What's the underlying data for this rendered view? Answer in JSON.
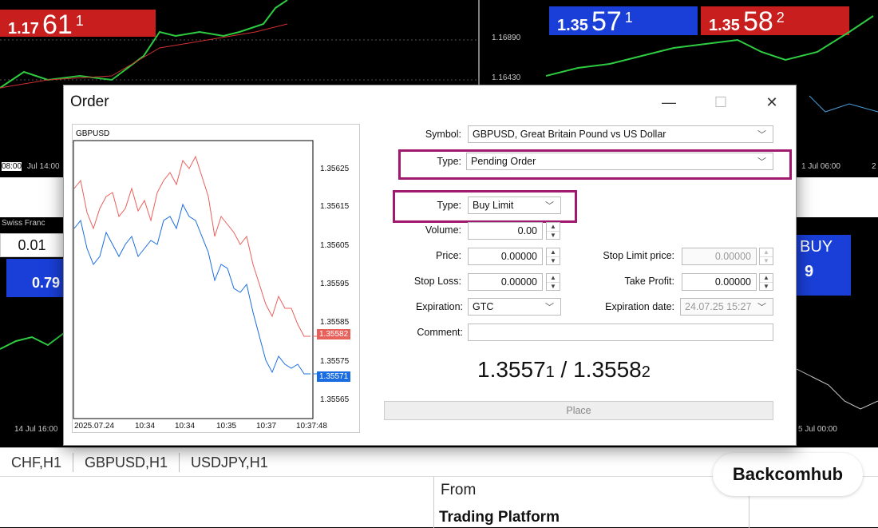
{
  "background": {
    "chart_tl": {
      "bid_small": "1.17",
      "bid_big": "61",
      "bid_sup": "1",
      "axis_labels": [
        "1.16890",
        "1.16430"
      ],
      "time_labels": [
        "08:00",
        "Jul 14:00"
      ]
    },
    "chart_tr": {
      "bid_small": "1.35",
      "bid_big": "57",
      "bid_sup": "1",
      "ask_small": "1.35",
      "ask_big": "58",
      "ask_sup": "2",
      "time_labels": [
        "1 Jul 06:00",
        "2"
      ]
    },
    "chart_ml": {
      "title": "Swiss Franc",
      "lot": "0.01",
      "price": "0.79"
    },
    "chart_mr": {
      "buy_label": "BUY",
      "price": "9"
    },
    "chart_bl": {
      "time_label": "14 Jul 16:00"
    },
    "chart_br": {
      "time_label": "5 Jul 00:00"
    }
  },
  "bottom_tabs": [
    "CHF,H1",
    "GBPUSD,H1",
    "USDJPY,H1"
  ],
  "lower_panel": {
    "from": "From",
    "trading_platform": "Trading Platform"
  },
  "logo": "Backcomhub",
  "dialog": {
    "title": "Order",
    "buttons": {
      "minimize": "—",
      "maximize": "☐",
      "close": "✕"
    },
    "mini_chart": {
      "symbol": "GBPUSD",
      "y_ticks": [
        "1.35625",
        "1.35615",
        "1.35605",
        "1.35595",
        "1.35585",
        "1.35575",
        "1.35565"
      ],
      "x_ticks": [
        "2025.07.24",
        "10:34",
        "10:34",
        "10:35",
        "10:37",
        "10:37:48"
      ],
      "ask_tag": "1.35582",
      "bid_tag": "1.35571",
      "colors": {
        "ask": "#e8605a",
        "bid": "#1a6de0"
      }
    },
    "form": {
      "symbol_label": "Symbol:",
      "symbol_value": "GBPUSD, Great Britain Pound vs US Dollar",
      "type_label": "Type:",
      "type_value": "Pending Order",
      "subtype_label": "Type:",
      "subtype_value": "Buy Limit",
      "volume_label": "Volume:",
      "volume_value": "0.00",
      "price_label": "Price:",
      "price_value": "0.00000",
      "stop_limit_label": "Stop Limit price:",
      "stop_limit_value": "0.00000",
      "stop_loss_label": "Stop Loss:",
      "stop_loss_value": "0.00000",
      "take_profit_label": "Take Profit:",
      "take_profit_value": "0.00000",
      "expiration_label": "Expiration:",
      "expiration_value": "GTC",
      "expiration_date_label": "Expiration date:",
      "expiration_date_value": "24.07.25 15:27",
      "comment_label": "Comment:",
      "comment_value": ""
    },
    "quote": {
      "bid": "1.3557",
      "bid_sub": "1",
      "sep": " / ",
      "ask": "1.3558",
      "ask_sub": "2"
    },
    "place_label": "Place",
    "highlight_color": "#a0196e"
  }
}
